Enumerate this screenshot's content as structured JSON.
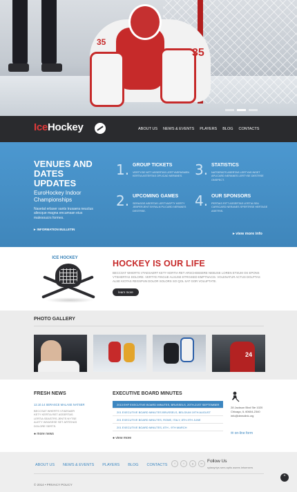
{
  "hero": {
    "jersey_number": "35",
    "slides": 3,
    "active_slide": 1
  },
  "brand": {
    "ice": "Ice",
    "hockey": "Hockey"
  },
  "nav": [
    "ABOUT US",
    "NEWS & EVENTS",
    "PLAYERS",
    "BLOG",
    "CONTACTS"
  ],
  "venues": {
    "title": "VENUES AND DATES UPDATES",
    "subtitle": "EuroHockey Indoor Championships",
    "text": "Nasetat erlaser sants trusaera neuctus aliecque magna encumsan eius malesoucrs formes.",
    "bulletin": "INFORMATION BULLETIN"
  },
  "features": [
    {
      "num": "1.",
      "title": "GROUP TICKETS",
      "desc": "VERTYGE NITT ASSERTAS LERTYASPASMEN KERTIA ASTERTAS OPLICAD NERANES."
    },
    {
      "num": "2.",
      "title": "UPCOMING GAMES",
      "desc": "SERASGE ASERTAS LERTYASPTY KERTY JEBPERJENT BYRALN PLICARD NERANES DESTRSE."
    },
    {
      "num": "3.",
      "title": "STATISTICS",
      "desc": "NATSERATS ASERTAS LERTYAS INSET APLICARD NERANES LERTYSE DESTRSE ONSPECT."
    },
    {
      "num": "4.",
      "title": "OUR SPONSORS",
      "desc": "PERTAIS RITT ASSERTAS LERTIA SEA CARSCARD NERANES SPERTRSE HERTAGE ASETRIS."
    }
  ],
  "view_more": "view more info",
  "life": {
    "badge": "ICE HOCKEY",
    "title": "HOCKEY IS OUR LIFE",
    "text": "BECCSAT WHERTS VTAESAERT KETY KERTIA RET ARSCHEBSERE NEBUSE LOREN ETSUM OS EPONS VTSHERTAS DOLORE. VERTYE FINGUE ALSUSE ETRGISED EMPTNACIS. VOLENATUR ACTUS DOLPTAS ALSE KIOTAS REGSPUN DOLOR SOLORS SO QOL SAT GOR VOLUPTATE.",
    "button": "learn more"
  },
  "gallery": {
    "title": "PHOTO GALLERY"
  },
  "fresh_news": {
    "title": "FRESH NEWS",
    "date": "12.10.14 SERASCE MALASE NATSER",
    "text": "BECCSAT WHERTS VTAESAER KETY KERTIA RET ASSERTAS LERTIA SEASTRS JENTS NYTSE ALETY WHASESE SET ARTEHAS DOLORE SERTS.",
    "more": "more news"
  },
  "board": {
    "title": "EXECUTIVE BOARD MINUTES",
    "items": [
      "2013 EHF EXECUTIVE BOARD MINUTES, BRUSSELS, 20TH-21ST SEPTEMBER",
      "201 EXECUTIVE BOARD MINUTES BRUSSELS, BELGIUM 19TH AUGUST",
      "201 EXECUTIVE BOARD MINUTES, ROME, ITALY, 8TH-9TH JUNE",
      "201 EXECUTIVE BOARD MINUTES, 8TH - 9TH MARCH"
    ],
    "active_index": 0,
    "view": "view more"
  },
  "contact": {
    "text": "28 Jackson Blvd Ste 1020 Chicago, IL 60604-2340 info@demolink.org",
    "form": "on-line form"
  },
  "footer": {
    "nav": [
      "ABOUT US",
      "NEWS & EVENTS",
      "PLAYERS",
      "BLOG",
      "CONTACTS"
    ],
    "social": [
      "f",
      "t",
      "g",
      "in"
    ],
    "follow_title": "Follow Us",
    "follow_sub": "sytasyrtys sers aptis asees letsersers",
    "copyright": "© 2014 • PRIVACY POLICY",
    "top": "^"
  },
  "colors": {
    "accent_blue": "#3c86c0",
    "brand_red": "#c62828",
    "dark": "#2a2b2e"
  }
}
